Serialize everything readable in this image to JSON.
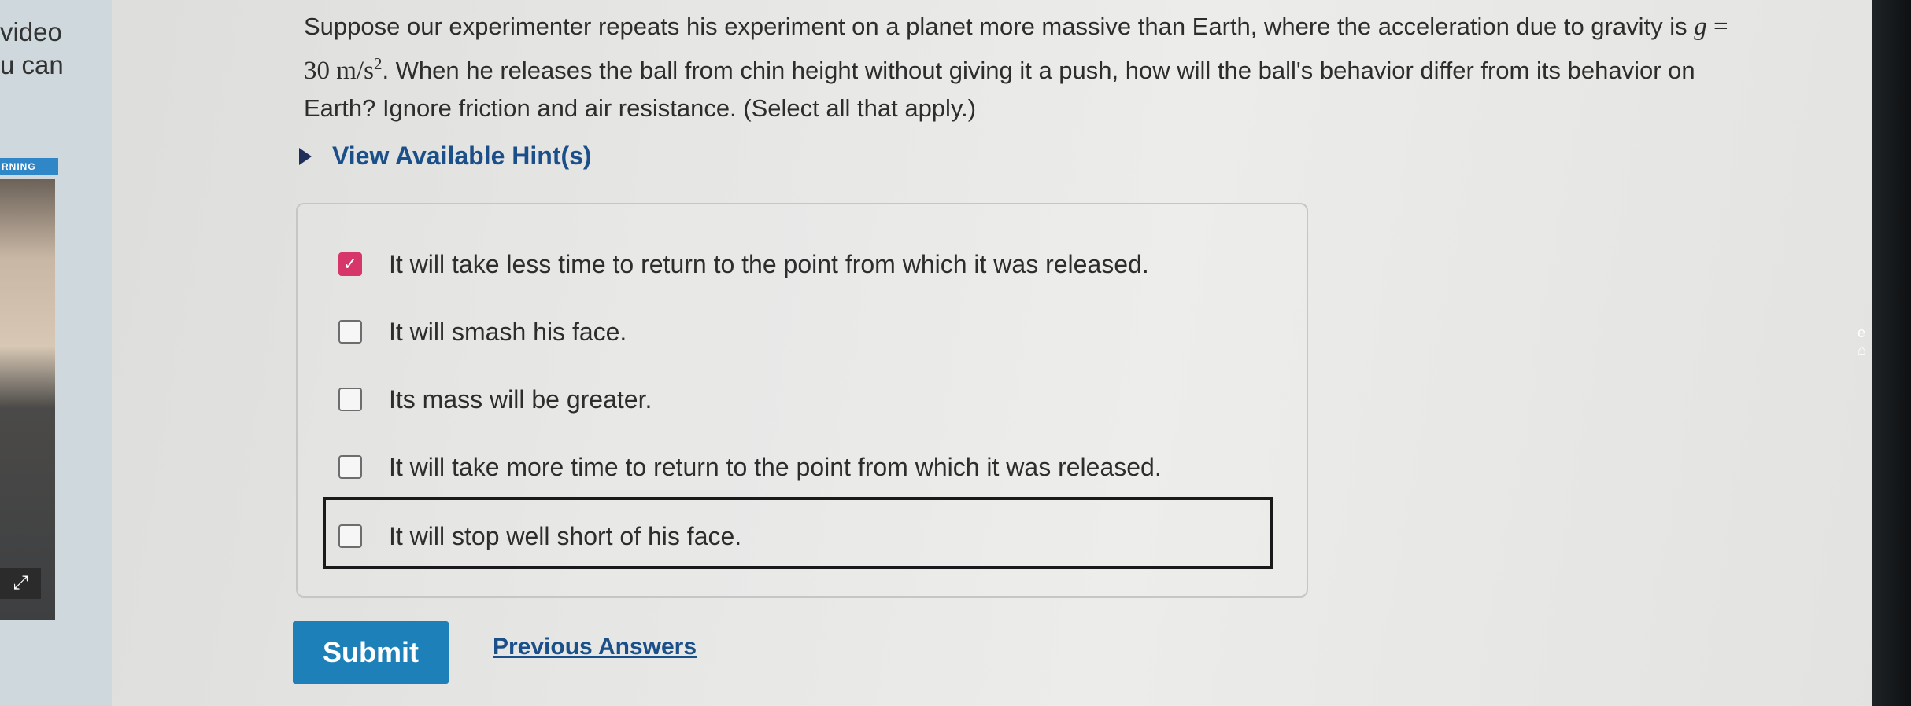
{
  "sidebar": {
    "text_line1": "video",
    "text_line2": "u can",
    "label": "RNING",
    "expand_icon": "expand-icon"
  },
  "question": {
    "text_before_math": "Suppose our experimenter repeats his experiment on a planet more massive than Earth, where the acceleration due to gravity is ",
    "math_var": "g",
    "math_eq": " = 30 m/s",
    "math_exp": "2",
    "text_after_math": ". When he releases the ball from chin height without giving it a push, how will the ball's behavior differ from its behavior on Earth? Ignore friction and air resistance. (Select all that apply.)"
  },
  "hint": {
    "label": "View Available Hint(s)",
    "icon": "caret-right-icon"
  },
  "options": [
    {
      "label": "It will take less time to return to the point from which it was released.",
      "checked": true
    },
    {
      "label": "It will smash his face.",
      "checked": false
    },
    {
      "label": "Its mass will be greater.",
      "checked": false
    },
    {
      "label": "It will take more time to return to the point from which it was released.",
      "checked": false
    },
    {
      "label": "It will stop well short of his face.",
      "checked": false
    }
  ],
  "actions": {
    "submit_label": "Submit",
    "previous_answers_label": "Previous Answers"
  },
  "colors": {
    "checked_box": "#d6366a",
    "submit_bg": "#1d80b8",
    "link": "#1a4f8a"
  }
}
